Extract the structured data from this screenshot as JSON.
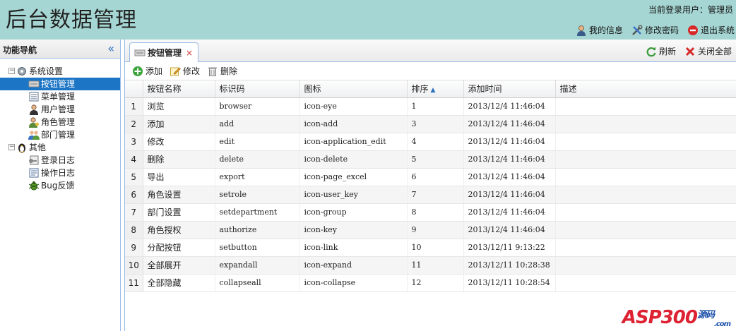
{
  "header": {
    "app_title": "后台数据管理",
    "current_user_label": "当前登录用户：管理员",
    "links": [
      {
        "label": "我的信息",
        "icon": "user-icon"
      },
      {
        "label": "修改密码",
        "icon": "tools-icon"
      },
      {
        "label": "退出系统",
        "icon": "exit-icon"
      }
    ]
  },
  "sidebar": {
    "title": "功能导航",
    "collapse_glyph": "«",
    "tree": [
      {
        "label": "系统设置",
        "icon": "gear-icon",
        "level": 0,
        "toggle": "−"
      },
      {
        "label": "按钮管理",
        "icon": "button-icon",
        "level": 1,
        "selected": true
      },
      {
        "label": "菜单管理",
        "icon": "menu-icon",
        "level": 1
      },
      {
        "label": "用户管理",
        "icon": "user-icon",
        "level": 1
      },
      {
        "label": "角色管理",
        "icon": "role-icon",
        "level": 1
      },
      {
        "label": "部门管理",
        "icon": "group-icon",
        "level": 1
      },
      {
        "label": "其他",
        "icon": "penguin-icon",
        "level": 0,
        "toggle": "−"
      },
      {
        "label": "登录日志",
        "icon": "login-log-icon",
        "level": 1
      },
      {
        "label": "操作日志",
        "icon": "log-icon",
        "level": 1
      },
      {
        "label": "Bug反馈",
        "icon": "bug-icon",
        "level": 1
      }
    ]
  },
  "tabs": {
    "active_tab": "按钮管理",
    "close_glyph": "×",
    "refresh_label": "刷新",
    "close_all_label": "关闭全部"
  },
  "toolbar": {
    "add_label": "添加",
    "edit_label": "修改",
    "delete_label": "删除"
  },
  "grid": {
    "columns": [
      "按钮名称",
      "标识码",
      "图标",
      "排序",
      "添加时间",
      "描述"
    ],
    "sort_glyph": "▲",
    "rows": [
      {
        "n": "1",
        "name": "浏览",
        "code": "browser",
        "icon": "icon-eye",
        "sort": "1",
        "time": "2013/12/4 11:46:04",
        "desc": ""
      },
      {
        "n": "2",
        "name": "添加",
        "code": "add",
        "icon": "icon-add",
        "sort": "3",
        "time": "2013/12/4 11:46:04",
        "desc": ""
      },
      {
        "n": "3",
        "name": "修改",
        "code": "edit",
        "icon": "icon-application_edit",
        "sort": "4",
        "time": "2013/12/4 11:46:04",
        "desc": ""
      },
      {
        "n": "4",
        "name": "删除",
        "code": "delete",
        "icon": "icon-delete",
        "sort": "5",
        "time": "2013/12/4 11:46:04",
        "desc": ""
      },
      {
        "n": "5",
        "name": "导出",
        "code": "export",
        "icon": "icon-page_excel",
        "sort": "6",
        "time": "2013/12/4 11:46:04",
        "desc": ""
      },
      {
        "n": "6",
        "name": "角色设置",
        "code": "setrole",
        "icon": "icon-user_key",
        "sort": "7",
        "time": "2013/12/4 11:46:04",
        "desc": ""
      },
      {
        "n": "7",
        "name": "部门设置",
        "code": "setdepartment",
        "icon": "icon-group",
        "sort": "8",
        "time": "2013/12/4 11:46:04",
        "desc": ""
      },
      {
        "n": "8",
        "name": "角色授权",
        "code": "authorize",
        "icon": "icon-key",
        "sort": "9",
        "time": "2013/12/4 11:46:04",
        "desc": ""
      },
      {
        "n": "9",
        "name": "分配按钮",
        "code": "setbutton",
        "icon": "icon-link",
        "sort": "10",
        "time": "2013/12/11 9:13:22",
        "desc": ""
      },
      {
        "n": "10",
        "name": "全部展开",
        "code": "expandall",
        "icon": "icon-expand",
        "sort": "11",
        "time": "2013/12/11 10:28:38",
        "desc": ""
      },
      {
        "n": "11",
        "name": "全部隐藏",
        "code": "collapseall",
        "icon": "icon-collapse",
        "sort": "12",
        "time": "2013/12/11 10:28:54",
        "desc": ""
      }
    ]
  },
  "watermark": {
    "main": "ASP300",
    "sub": "源码",
    "tld": ".com"
  }
}
